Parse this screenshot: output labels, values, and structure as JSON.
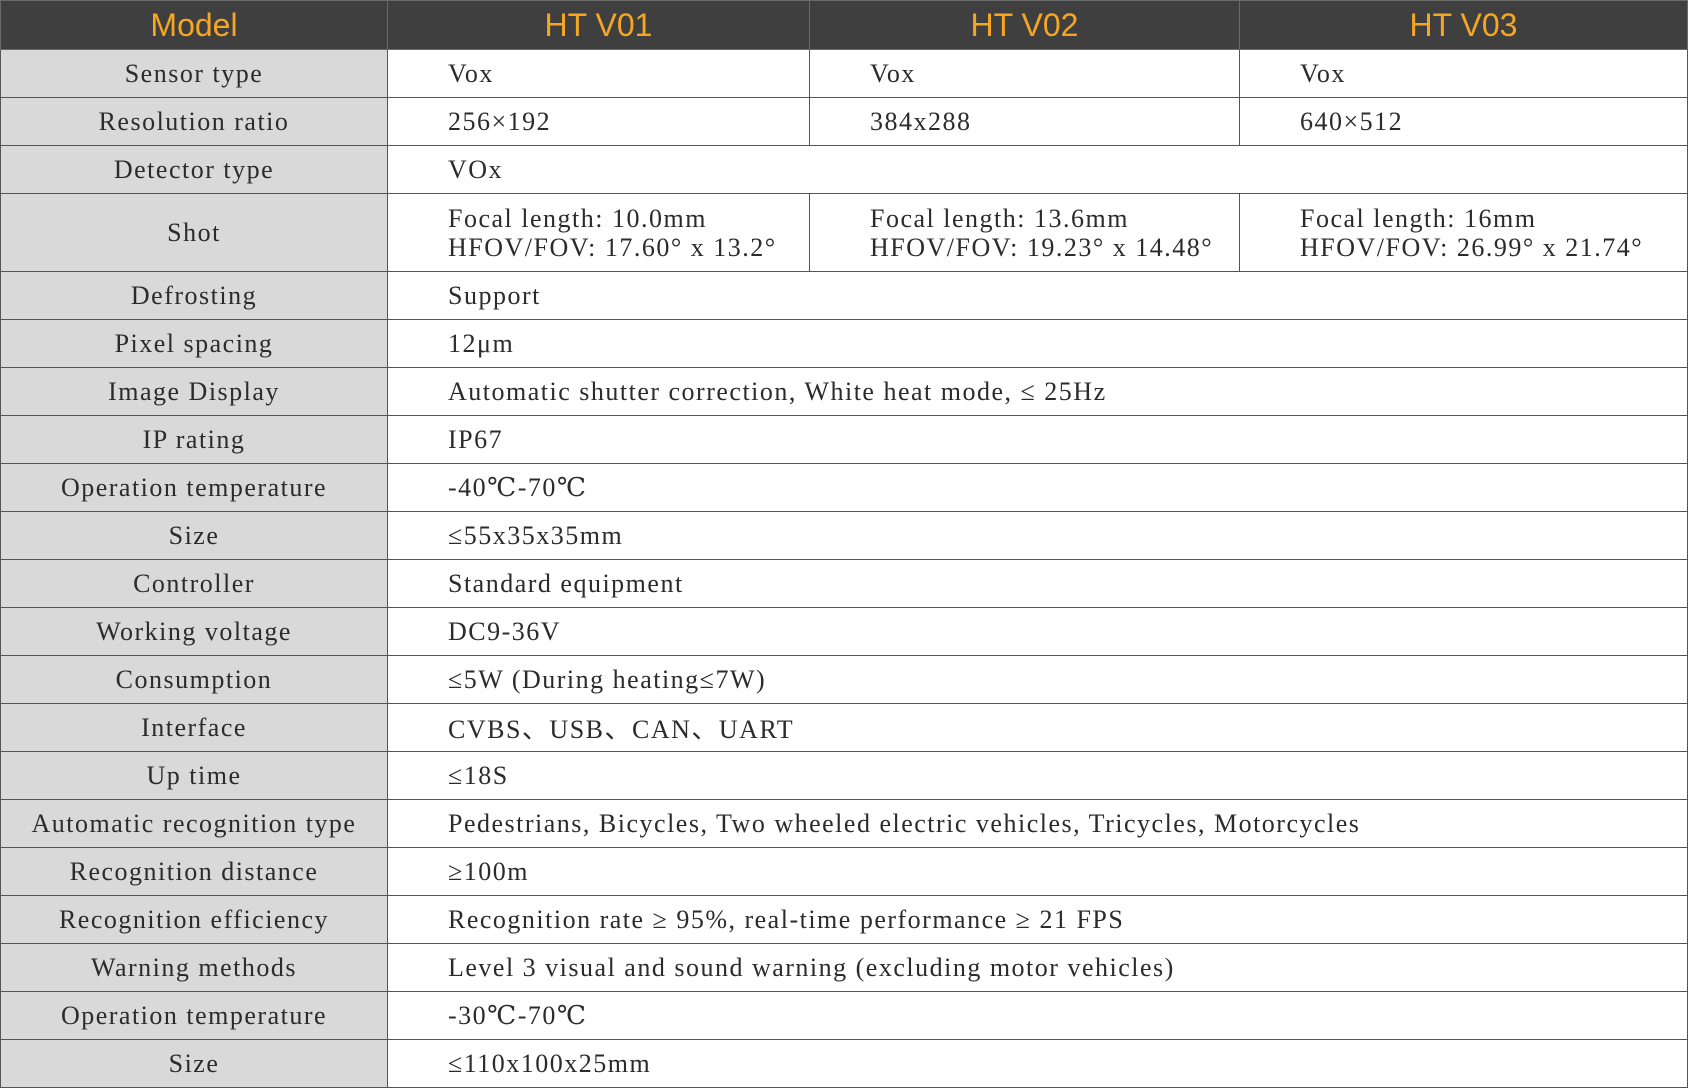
{
  "header": {
    "model_label": "Model",
    "models": [
      "HT V01",
      "HT V02",
      "HT V03"
    ]
  },
  "rows": [
    {
      "label": "Sensor type",
      "values": [
        "Vox",
        "Vox",
        "Vox"
      ]
    },
    {
      "label": "Resolution ratio",
      "values": [
        "256×192",
        "384x288",
        "640×512"
      ]
    },
    {
      "label": "Detector type",
      "value": "VOx"
    },
    {
      "label": "Shot",
      "values": [
        [
          "Focal length: 10.0mm",
          "HFOV/FOV: 17.60° x 13.2°"
        ],
        [
          "Focal length: 13.6mm",
          "HFOV/FOV: 19.23° x 14.48°"
        ],
        [
          "Focal length: 16mm",
          "HFOV/FOV: 26.99° x 21.74°"
        ]
      ]
    },
    {
      "label": "Defrosting",
      "value": "Support"
    },
    {
      "label": "Pixel spacing",
      "value": "12μm"
    },
    {
      "label": "Image Display",
      "value": "Automatic shutter correction, White heat mode, ≤ 25Hz"
    },
    {
      "label": "IP rating",
      "value": "IP67"
    },
    {
      "label": "Operation temperature",
      "value": "-40℃-70℃"
    },
    {
      "label": "Size",
      "value": "≤55x35x35mm"
    },
    {
      "label": "Controller",
      "value": "Standard equipment"
    },
    {
      "label": "Working voltage",
      "value": "DC9-36V"
    },
    {
      "label": "Consumption",
      "value": "≤5W (During heating≤7W)"
    },
    {
      "label": "Interface",
      "value": "CVBS、USB、CAN、UART"
    },
    {
      "label": "Up time",
      "value": "≤18S"
    },
    {
      "label": "Automatic recognition type",
      "value": "Pedestrians, Bicycles, Two wheeled electric vehicles, Tricycles, Motorcycles"
    },
    {
      "label": "Recognition distance",
      "value": "≥100m"
    },
    {
      "label": "Recognition efficiency",
      "value": "Recognition rate ≥ 95%, real-time performance ≥ 21 FPS"
    },
    {
      "label": "Warning methods",
      "value": "Level 3 visual and sound warning (excluding motor vehicles)"
    },
    {
      "label": "Operation temperature",
      "value": "-30℃-70℃"
    },
    {
      "label": "Size",
      "value": "≤110x100x25mm"
    }
  ],
  "colors": {
    "header_bg": "#3f3f3f",
    "header_text": "#f5a623",
    "label_bg": "#d9d9d9",
    "border": "#555555"
  }
}
